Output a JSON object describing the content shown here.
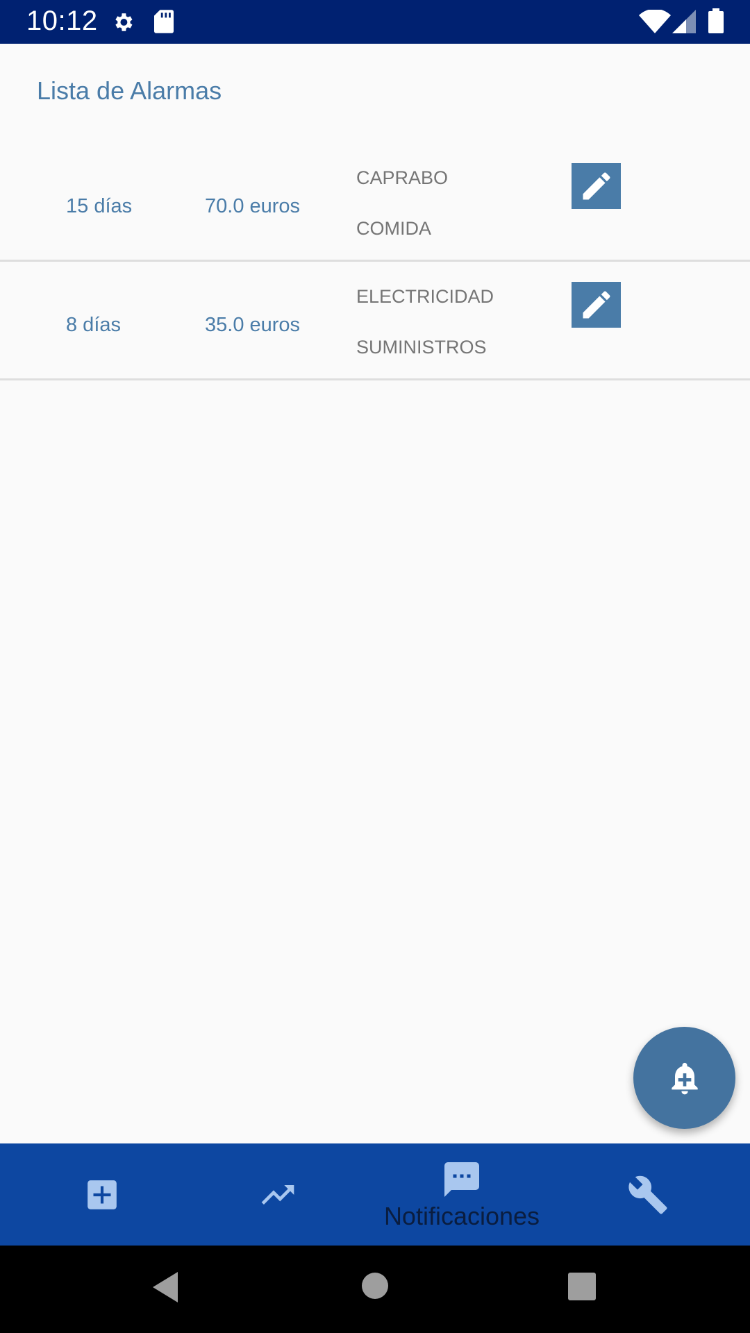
{
  "status_bar": {
    "time": "10:12",
    "icons": [
      "settings-icon",
      "sd-card-icon",
      "wifi-icon",
      "signal-icon",
      "battery-icon"
    ]
  },
  "page": {
    "title": "Lista de Alarmas"
  },
  "alarms": [
    {
      "days": "15 días",
      "amount": "70.0 euros",
      "name": "CAPRABO",
      "category": "COMIDA"
    },
    {
      "days": "8 días",
      "amount": "35.0 euros",
      "name": "ELECTRICIDAD",
      "category": "SUMINISTROS"
    }
  ],
  "fab": {
    "icon": "add-alarm-bell-icon"
  },
  "bottom_nav": {
    "items": [
      {
        "icon": "add-box-icon",
        "label": ""
      },
      {
        "icon": "trending-up-icon",
        "label": ""
      },
      {
        "icon": "chat-icon",
        "label": "Notificaciones"
      },
      {
        "icon": "wrench-icon",
        "label": ""
      }
    ],
    "active_index": 2
  },
  "colors": {
    "status_bar": "#002171",
    "accent": "#4a7ca8",
    "bottom_nav": "#0d47a1",
    "nav_icon": "#a9c7ef",
    "fab": "#44739f"
  }
}
